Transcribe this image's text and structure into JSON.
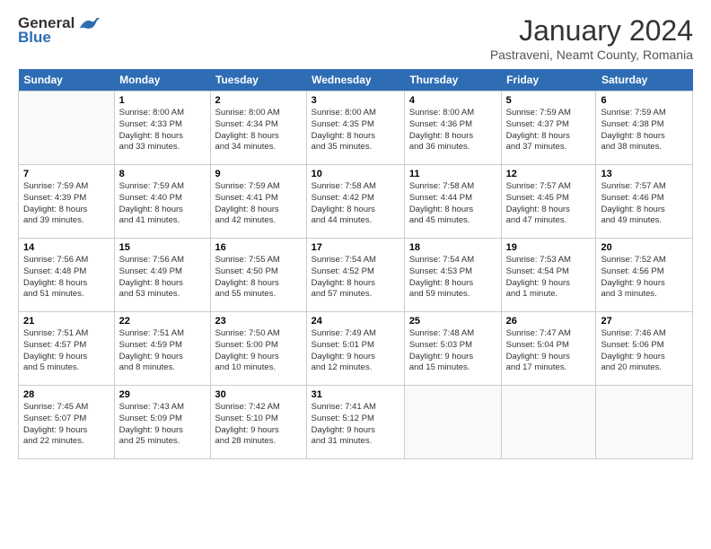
{
  "logo": {
    "general": "General",
    "blue": "Blue"
  },
  "title": "January 2024",
  "subtitle": "Pastraveni, Neamt County, Romania",
  "headers": [
    "Sunday",
    "Monday",
    "Tuesday",
    "Wednesday",
    "Thursday",
    "Friday",
    "Saturday"
  ],
  "weeks": [
    [
      {
        "date": "",
        "content": ""
      },
      {
        "date": "1",
        "content": "Sunrise: 8:00 AM\nSunset: 4:33 PM\nDaylight: 8 hours\nand 33 minutes."
      },
      {
        "date": "2",
        "content": "Sunrise: 8:00 AM\nSunset: 4:34 PM\nDaylight: 8 hours\nand 34 minutes."
      },
      {
        "date": "3",
        "content": "Sunrise: 8:00 AM\nSunset: 4:35 PM\nDaylight: 8 hours\nand 35 minutes."
      },
      {
        "date": "4",
        "content": "Sunrise: 8:00 AM\nSunset: 4:36 PM\nDaylight: 8 hours\nand 36 minutes."
      },
      {
        "date": "5",
        "content": "Sunrise: 7:59 AM\nSunset: 4:37 PM\nDaylight: 8 hours\nand 37 minutes."
      },
      {
        "date": "6",
        "content": "Sunrise: 7:59 AM\nSunset: 4:38 PM\nDaylight: 8 hours\nand 38 minutes."
      }
    ],
    [
      {
        "date": "7",
        "content": "Sunrise: 7:59 AM\nSunset: 4:39 PM\nDaylight: 8 hours\nand 39 minutes."
      },
      {
        "date": "8",
        "content": "Sunrise: 7:59 AM\nSunset: 4:40 PM\nDaylight: 8 hours\nand 41 minutes."
      },
      {
        "date": "9",
        "content": "Sunrise: 7:59 AM\nSunset: 4:41 PM\nDaylight: 8 hours\nand 42 minutes."
      },
      {
        "date": "10",
        "content": "Sunrise: 7:58 AM\nSunset: 4:42 PM\nDaylight: 8 hours\nand 44 minutes."
      },
      {
        "date": "11",
        "content": "Sunrise: 7:58 AM\nSunset: 4:44 PM\nDaylight: 8 hours\nand 45 minutes."
      },
      {
        "date": "12",
        "content": "Sunrise: 7:57 AM\nSunset: 4:45 PM\nDaylight: 8 hours\nand 47 minutes."
      },
      {
        "date": "13",
        "content": "Sunrise: 7:57 AM\nSunset: 4:46 PM\nDaylight: 8 hours\nand 49 minutes."
      }
    ],
    [
      {
        "date": "14",
        "content": "Sunrise: 7:56 AM\nSunset: 4:48 PM\nDaylight: 8 hours\nand 51 minutes."
      },
      {
        "date": "15",
        "content": "Sunrise: 7:56 AM\nSunset: 4:49 PM\nDaylight: 8 hours\nand 53 minutes."
      },
      {
        "date": "16",
        "content": "Sunrise: 7:55 AM\nSunset: 4:50 PM\nDaylight: 8 hours\nand 55 minutes."
      },
      {
        "date": "17",
        "content": "Sunrise: 7:54 AM\nSunset: 4:52 PM\nDaylight: 8 hours\nand 57 minutes."
      },
      {
        "date": "18",
        "content": "Sunrise: 7:54 AM\nSunset: 4:53 PM\nDaylight: 8 hours\nand 59 minutes."
      },
      {
        "date": "19",
        "content": "Sunrise: 7:53 AM\nSunset: 4:54 PM\nDaylight: 9 hours\nand 1 minute."
      },
      {
        "date": "20",
        "content": "Sunrise: 7:52 AM\nSunset: 4:56 PM\nDaylight: 9 hours\nand 3 minutes."
      }
    ],
    [
      {
        "date": "21",
        "content": "Sunrise: 7:51 AM\nSunset: 4:57 PM\nDaylight: 9 hours\nand 5 minutes."
      },
      {
        "date": "22",
        "content": "Sunrise: 7:51 AM\nSunset: 4:59 PM\nDaylight: 9 hours\nand 8 minutes."
      },
      {
        "date": "23",
        "content": "Sunrise: 7:50 AM\nSunset: 5:00 PM\nDaylight: 9 hours\nand 10 minutes."
      },
      {
        "date": "24",
        "content": "Sunrise: 7:49 AM\nSunset: 5:01 PM\nDaylight: 9 hours\nand 12 minutes."
      },
      {
        "date": "25",
        "content": "Sunrise: 7:48 AM\nSunset: 5:03 PM\nDaylight: 9 hours\nand 15 minutes."
      },
      {
        "date": "26",
        "content": "Sunrise: 7:47 AM\nSunset: 5:04 PM\nDaylight: 9 hours\nand 17 minutes."
      },
      {
        "date": "27",
        "content": "Sunrise: 7:46 AM\nSunset: 5:06 PM\nDaylight: 9 hours\nand 20 minutes."
      }
    ],
    [
      {
        "date": "28",
        "content": "Sunrise: 7:45 AM\nSunset: 5:07 PM\nDaylight: 9 hours\nand 22 minutes."
      },
      {
        "date": "29",
        "content": "Sunrise: 7:43 AM\nSunset: 5:09 PM\nDaylight: 9 hours\nand 25 minutes."
      },
      {
        "date": "30",
        "content": "Sunrise: 7:42 AM\nSunset: 5:10 PM\nDaylight: 9 hours\nand 28 minutes."
      },
      {
        "date": "31",
        "content": "Sunrise: 7:41 AM\nSunset: 5:12 PM\nDaylight: 9 hours\nand 31 minutes."
      },
      {
        "date": "",
        "content": ""
      },
      {
        "date": "",
        "content": ""
      },
      {
        "date": "",
        "content": ""
      }
    ]
  ]
}
